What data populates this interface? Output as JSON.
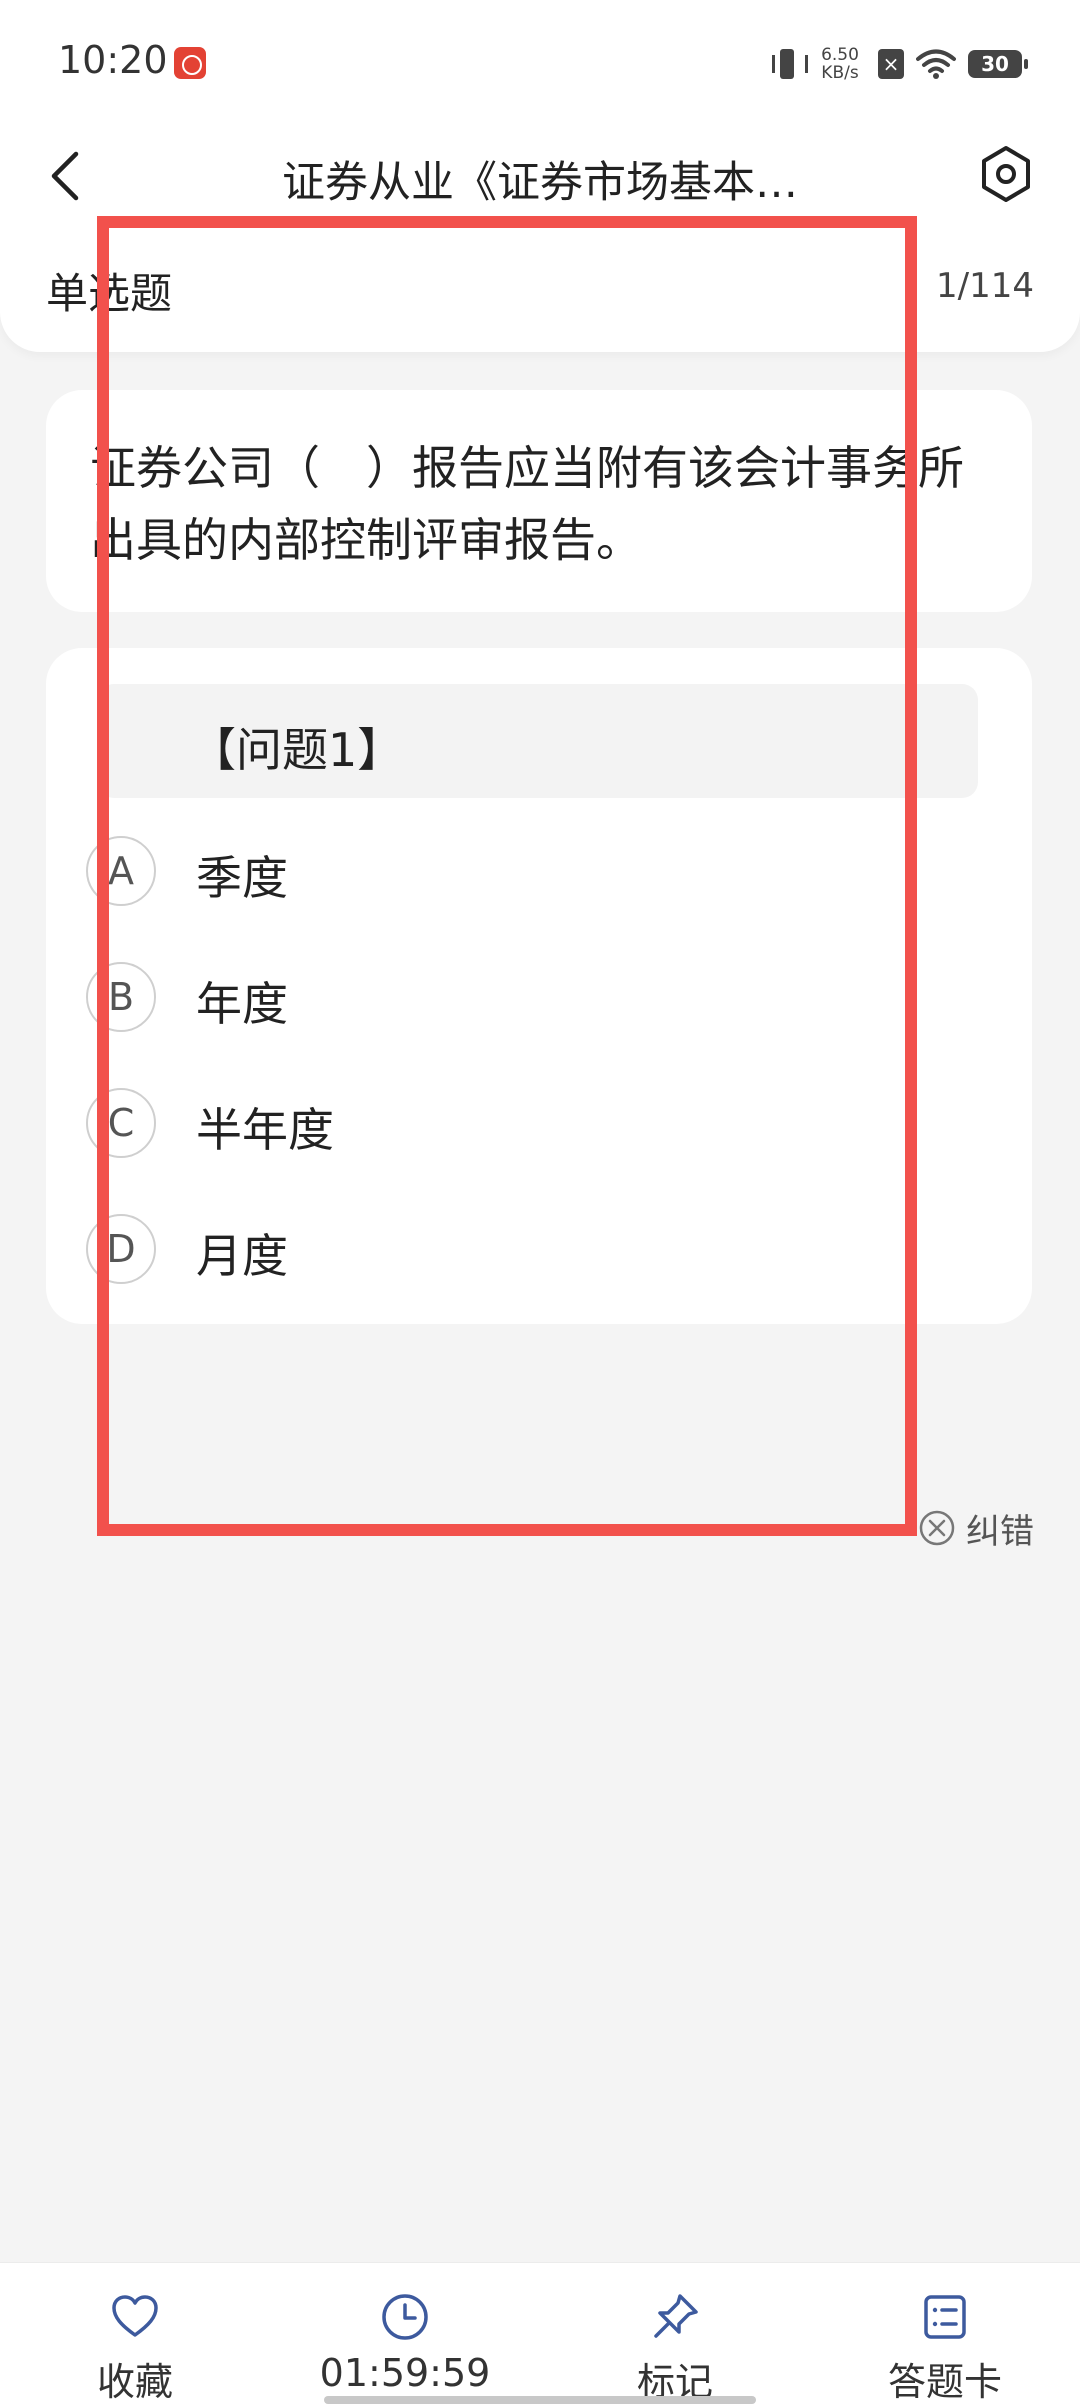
{
  "status_bar": {
    "time": "10:20",
    "net_speed_value": "6.50",
    "net_speed_unit": "KB/s",
    "battery": "30"
  },
  "nav": {
    "title": "证券从业《证券市场基本…"
  },
  "question": {
    "type": "单选题",
    "progress": "1/114",
    "stem": "证券公司（　）报告应当附有该会计事务所出具的内部控制评审报告。",
    "label": "【问题1】",
    "options": [
      {
        "letter": "A",
        "text": "季度"
      },
      {
        "letter": "B",
        "text": "年度"
      },
      {
        "letter": "C",
        "text": "半年度"
      },
      {
        "letter": "D",
        "text": "月度"
      }
    ]
  },
  "report_error": "纠错",
  "bottom_bar": {
    "favorite": "收藏",
    "timer": "01:59:59",
    "mark": "标记",
    "answer_card": "答题卡"
  },
  "colors": {
    "accent_blue": "#3d5a9e",
    "highlight_red": "#f2514c",
    "page_bg": "#f4f4f4"
  }
}
